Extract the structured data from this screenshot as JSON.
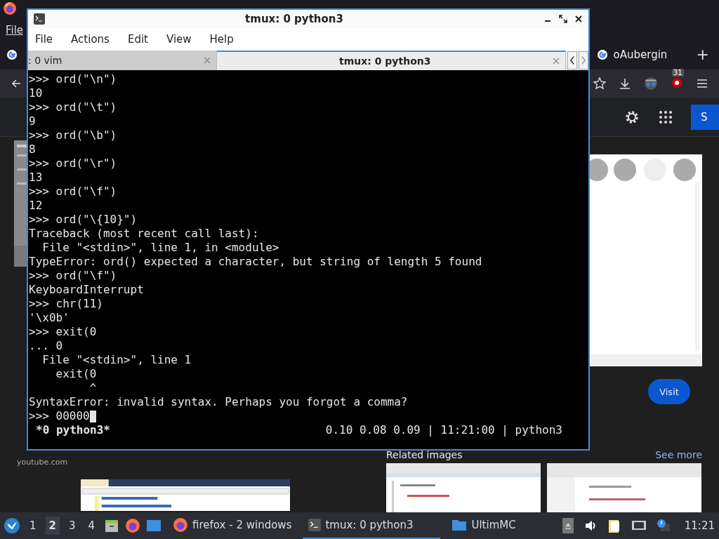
{
  "firefox": {
    "menu": [
      "File"
    ],
    "tabs": [
      {
        "label": "oAubergin",
        "selected": false
      }
    ],
    "new_tab": "+",
    "notification_badge": "31",
    "header_button": "S",
    "source": "youtube.com",
    "visit_button": "Visit",
    "related_title": "Related images",
    "see_more": "See more"
  },
  "terminal": {
    "title": "tmux: 0 python3",
    "menu": [
      "File",
      "Actions",
      "Edit",
      "View",
      "Help"
    ],
    "tabs": [
      {
        "label": ": 0 vim",
        "selected": false
      },
      {
        "label": "tmux: 0 python3",
        "selected": true
      }
    ],
    "lines": [
      ">>> ord(\"\\n\")",
      "10",
      ">>> ord(\"\\t\")",
      "9",
      ">>> ord(\"\\b\")",
      "8",
      ">>> ord(\"\\r\")",
      "13",
      ">>> ord(\"\\f\")",
      "12",
      ">>> ord(\"\\{10}\")",
      "Traceback (most recent call last):",
      "  File \"<stdin>\", line 1, in <module>",
      "TypeError: ord() expected a character, but string of length 5 found",
      ">>> ord(\"\\f\")",
      "KeyboardInterrupt",
      ">>> chr(11)",
      "'\\x0b'",
      ">>> exit(0",
      "... 0",
      "  File \"<stdin>\", line 1",
      "    exit(0",
      "         ^",
      "SyntaxError: invalid syntax. Perhaps you forgot a comma?",
      ">>> 00000"
    ],
    "status_left": "*0 python3*",
    "status_right": "0.10 0.08 0.09 | 11:21:00 | python3"
  },
  "taskbar": {
    "workspaces": [
      {
        "label": "1",
        "selected": false
      },
      {
        "label": "2",
        "selected": true
      },
      {
        "label": "3",
        "selected": false
      },
      {
        "label": "4",
        "selected": false
      }
    ],
    "tasks": [
      {
        "label": "firefox - 2 windows",
        "kind": "firefox",
        "active": false
      },
      {
        "label": "tmux: 0 python3",
        "kind": "terminal",
        "active": true
      },
      {
        "label": "UltimMC",
        "kind": "folder",
        "active": false
      }
    ],
    "clock": "11:21"
  }
}
